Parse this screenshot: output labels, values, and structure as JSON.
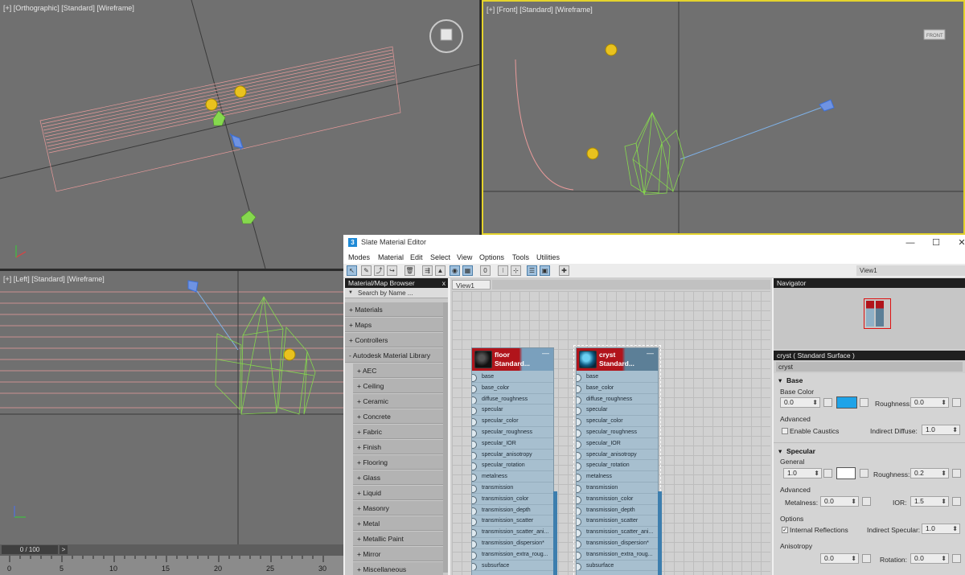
{
  "viewports": {
    "top_left_label": "[+] [Orthographic] [Standard] [Wireframe]",
    "top_right_label": "[+] [Front] [Standard] [Wireframe]",
    "bottom_left_label": "[+] [Left] [Standard] [Wireframe]",
    "viewcube_front": "FRONT"
  },
  "timeline": {
    "frame": "0 / 100",
    "next": ">",
    "ticks": [
      "0",
      "5",
      "10",
      "15",
      "20",
      "25",
      "30"
    ]
  },
  "editor": {
    "title": "Slate Material Editor",
    "app_icon": "3",
    "window_controls": [
      "—",
      "☐",
      "✕"
    ],
    "menu": [
      "Modes",
      "Material",
      "Edit",
      "Select",
      "View",
      "Options",
      "Tools",
      "Utilities"
    ],
    "view_tab_top": "View1",
    "browser": {
      "title": "Material/Map Browser",
      "close": "x",
      "search_placeholder": "Search by Name ...",
      "items": [
        "+ Materials",
        "+ Maps",
        "+ Controllers",
        "- Autodesk Material Library"
      ],
      "sub_items": [
        "+ AEC",
        "+ Ceiling",
        "+ Ceramic",
        "+ Concrete",
        "+ Fabric",
        "+ Finish",
        "+ Flooring",
        "+ Glass",
        "+ Liquid",
        "+ Masonry",
        "+ Metal",
        "+ Metallic Paint",
        "+ Mirror",
        "+ Miscellaneous"
      ]
    },
    "view": {
      "tab": "View1",
      "nodes": [
        {
          "name": "floor",
          "type": "Standard..."
        },
        {
          "name": "cryst",
          "type": "Standard..."
        }
      ],
      "minimize": "—",
      "slots": [
        "base",
        "base_color",
        "diffuse_roughness",
        "specular",
        "specular_color",
        "specular_roughness",
        "specular_IOR",
        "specular_anisotropy",
        "specular_rotation",
        "metalness",
        "transmission",
        "transmission_color",
        "transmission_depth",
        "transmission_scatter",
        "transmission_scatter_ani...",
        "transmission_dispersion*",
        "transmission_extra_roug...",
        "subsurface"
      ]
    },
    "navigator": {
      "title": "Navigator"
    },
    "properties": {
      "title": "cryst  ( Standard Surface )",
      "name_field": "cryst",
      "base": {
        "section": "Base",
        "color_label": "Base Color",
        "weight": "0.0",
        "roughness_label": "Roughness:",
        "roughness": "0.0",
        "advanced": "Advanced",
        "caustics": "Enable Caustics",
        "indirect_diffuse_label": "Indirect Diffuse:",
        "indirect_diffuse": "1.0",
        "swatch_color": "#1ea3e8"
      },
      "specular": {
        "section": "Specular",
        "general": "General",
        "weight": "1.0",
        "roughness_label": "Roughness:",
        "roughness": "0.2",
        "advanced": "Advanced",
        "metalness_label": "Metalness:",
        "metalness": "0.0",
        "ior_label": "IOR:",
        "ior": "1.5",
        "options": "Options",
        "internal_reflections": "Internal Reflections",
        "indirect_specular_label": "Indirect Specular:",
        "indirect_specular": "1.0",
        "anisotropy": "Anisotropy",
        "aniso_value": "0.0",
        "rotation_label": "Rotation:",
        "rotation": "0.0",
        "swatch_color": "#ffffff"
      }
    }
  }
}
